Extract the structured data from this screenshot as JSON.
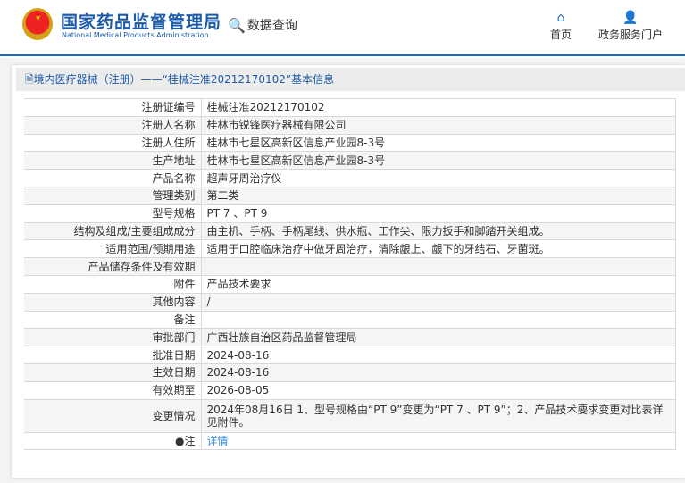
{
  "header": {
    "brand_cn": "国家药品监督管理局",
    "brand_en": "National Medical Products Administration",
    "data_query": "数据查询",
    "nav": [
      {
        "label": "首页",
        "icon": "home-icon"
      },
      {
        "label": "政务服务门户",
        "icon": "user-icon"
      }
    ]
  },
  "page_title": "境内医疗器械（注册）——“桂械注准20212170102”基本信息",
  "rows": [
    {
      "label": "注册证编号",
      "value": "桂械注准20212170102"
    },
    {
      "label": "注册人名称",
      "value": "桂林市锐锋医疗器械有限公司"
    },
    {
      "label": "注册人住所",
      "value": "桂林市七星区高新区信息产业园8-3号"
    },
    {
      "label": "生产地址",
      "value": "桂林市七星区高新区信息产业园8-3号"
    },
    {
      "label": "产品名称",
      "value": "超声牙周治疗仪"
    },
    {
      "label": "管理类别",
      "value": "第二类"
    },
    {
      "label": "型号规格",
      "value": "PT 7 、PT 9"
    },
    {
      "label": "结构及组成/主要组成成分",
      "value": "由主机、手柄、手柄尾线、供水瓶、工作尖、限力扳手和脚踏开关组成。"
    },
    {
      "label": "适用范围/预期用途",
      "value": "适用于口腔临床治疗中做牙周治疗，清除龈上、龈下的牙结石、牙菌斑。"
    },
    {
      "label": "产品储存条件及有效期",
      "value": ""
    },
    {
      "label": "附件",
      "value": "产品技术要求"
    },
    {
      "label": "其他内容",
      "value": "/"
    },
    {
      "label": "备注",
      "value": ""
    },
    {
      "label": "审批部门",
      "value": "广西壮族自治区药品监督管理局"
    },
    {
      "label": "批准日期",
      "value": "2024-08-16"
    },
    {
      "label": "生效日期",
      "value": "2024-08-16"
    },
    {
      "label": "有效期至",
      "value": "2026-08-05"
    },
    {
      "label": "变更情况",
      "value": "2024年08月16日 1、型号规格由“PT 9”变更为“PT 7 、PT 9”；2、产品技术要求变更对比表详见附件。"
    },
    {
      "label": "注",
      "value": "详情"
    }
  ]
}
